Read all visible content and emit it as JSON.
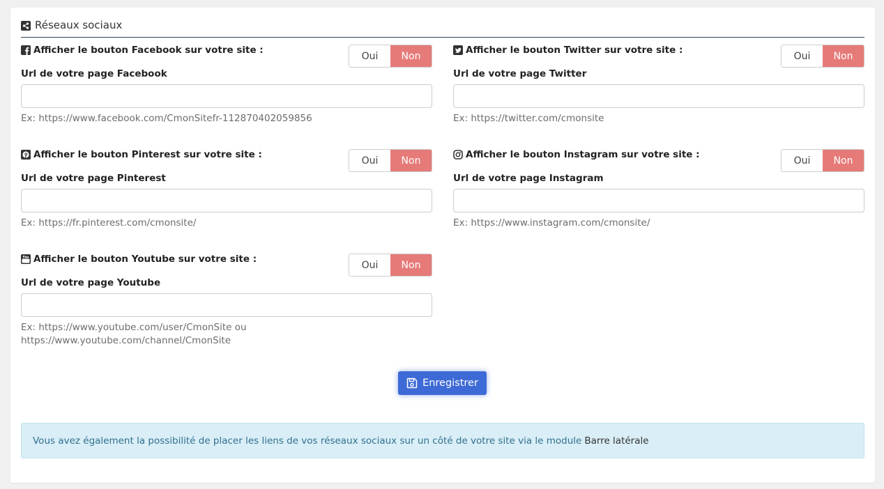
{
  "section": {
    "title": "Réseaux sociaux",
    "icon": "share-icon"
  },
  "toggle": {
    "yes": "Oui",
    "no": "Non",
    "active_color": "#e67a78"
  },
  "networks": {
    "facebook": {
      "label": "Afficher le bouton Facebook sur votre site :",
      "url_label": "Url de votre page Facebook",
      "url_value": "",
      "example": "Ex: https://www.facebook.com/CmonSitefr-112870402059856",
      "selected": "Non",
      "icon": "facebook-icon"
    },
    "twitter": {
      "label": "Afficher le bouton Twitter sur votre site :",
      "url_label": "Url de votre page Twitter",
      "url_value": "",
      "example": "Ex: https://twitter.com/cmonsite",
      "selected": "Non",
      "icon": "twitter-icon"
    },
    "pinterest": {
      "label": "Afficher le bouton Pinterest sur votre site :",
      "url_label": "Url de votre page Pinterest",
      "url_value": "",
      "example": "Ex: https://fr.pinterest.com/cmonsite/",
      "selected": "Non",
      "icon": "pinterest-icon"
    },
    "instagram": {
      "label": "Afficher le bouton Instagram sur votre site :",
      "url_label": "Url de votre page Instagram",
      "url_value": "",
      "example": "Ex: https://www.instagram.com/cmonsite/",
      "selected": "Non",
      "icon": "instagram-icon"
    },
    "youtube": {
      "label": "Afficher le bouton Youtube sur votre site :",
      "url_label": "Url de votre page Youtube",
      "url_value": "",
      "example_line1": "Ex: https://www.youtube.com/user/CmonSite ou",
      "example_line2": "https://www.youtube.com/channel/CmonSite",
      "selected": "Non",
      "icon": "youtube-icon"
    }
  },
  "save_button": {
    "label": "Enregistrer",
    "icon": "floppy-disk-icon",
    "color": "#3d6ad6"
  },
  "info": {
    "text": "Vous avez également la possibilité de placer les liens de vos réseaux sociaux sur un côté de votre site via le module",
    "link": "Barre latérale",
    "bg_color": "#d9eef6"
  }
}
